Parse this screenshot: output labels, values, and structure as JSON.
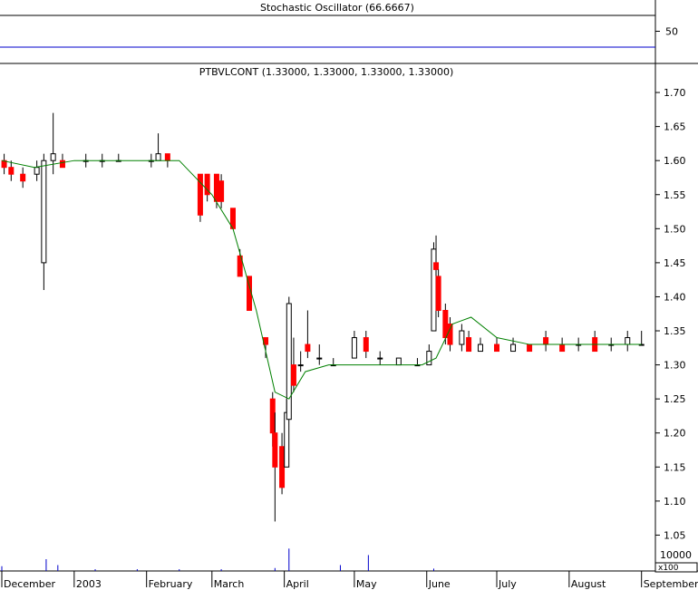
{
  "chart_data": [
    {
      "type": "line",
      "title": "Stochastic Oscillator (66.6667)",
      "ylim": [
        0,
        100
      ],
      "y_ticks": [
        50
      ],
      "ref_lines": [
        {
          "value": 80,
          "color": "#000000"
        },
        {
          "value": 20,
          "color": "#0000cc"
        }
      ],
      "series": [],
      "colors": {
        "line": "#cc0000"
      }
    },
    {
      "type": "candlestick",
      "title": "PTBVLCONT (1.33000, 1.33000, 1.33000, 1.33000)",
      "ylim": [
        1.0,
        1.74
      ],
      "y_ticks": [
        "1.05",
        "1.10",
        "1.15",
        "1.20",
        "1.25",
        "1.30",
        "1.35",
        "1.40",
        "1.45",
        "1.50",
        "1.55",
        "1.60",
        "1.65",
        "1.70"
      ],
      "moving_average": {
        "color": "#008000",
        "points": [
          [
            "2002-12-01",
            1.6
          ],
          [
            "2002-12-15",
            1.59
          ],
          [
            "2003-01-01",
            1.6
          ],
          [
            "2003-01-15",
            1.6
          ],
          [
            "2003-02-01",
            1.6
          ],
          [
            "2003-02-15",
            1.6
          ],
          [
            "2003-03-01",
            1.55
          ],
          [
            "2003-03-10",
            1.5
          ],
          [
            "2003-03-20",
            1.38
          ],
          [
            "2003-03-28",
            1.26
          ],
          [
            "2003-04-03",
            1.25
          ],
          [
            "2003-04-10",
            1.29
          ],
          [
            "2003-04-20",
            1.3
          ],
          [
            "2003-05-01",
            1.3
          ],
          [
            "2003-05-15",
            1.3
          ],
          [
            "2003-05-30",
            1.3
          ],
          [
            "2003-06-05",
            1.31
          ],
          [
            "2003-06-12",
            1.36
          ],
          [
            "2003-06-20",
            1.37
          ],
          [
            "2003-07-01",
            1.34
          ],
          [
            "2003-07-15",
            1.33
          ],
          [
            "2003-08-01",
            1.33
          ],
          [
            "2003-08-15",
            1.33
          ],
          [
            "2003-09-01",
            1.33
          ]
        ]
      },
      "candles": [
        [
          "2002-12-02",
          1.6,
          1.61,
          1.58,
          1.59
        ],
        [
          "2002-12-05",
          1.59,
          1.6,
          1.57,
          1.58
        ],
        [
          "2002-12-10",
          1.58,
          1.59,
          1.56,
          1.57
        ],
        [
          "2002-12-16",
          1.58,
          1.6,
          1.57,
          1.59
        ],
        [
          "2002-12-19",
          1.45,
          1.61,
          1.41,
          1.6
        ],
        [
          "2002-12-23",
          1.6,
          1.67,
          1.58,
          1.61
        ],
        [
          "2002-12-27",
          1.6,
          1.61,
          1.59,
          1.59
        ],
        [
          "2003-01-06",
          1.6,
          1.61,
          1.59,
          1.6
        ],
        [
          "2003-01-13",
          1.6,
          1.61,
          1.59,
          1.6
        ],
        [
          "2003-01-20",
          1.6,
          1.61,
          1.6,
          1.6
        ],
        [
          "2003-02-03",
          1.6,
          1.61,
          1.59,
          1.6
        ],
        [
          "2003-02-06",
          1.6,
          1.64,
          1.6,
          1.61
        ],
        [
          "2003-02-10",
          1.61,
          1.61,
          1.59,
          1.6
        ],
        [
          "2003-02-24",
          1.58,
          1.58,
          1.51,
          1.52
        ],
        [
          "2003-02-27",
          1.58,
          1.58,
          1.54,
          1.55
        ],
        [
          "2003-03-03",
          1.58,
          1.58,
          1.53,
          1.54
        ],
        [
          "2003-03-05",
          1.57,
          1.58,
          1.53,
          1.54
        ],
        [
          "2003-03-10",
          1.53,
          1.53,
          1.5,
          1.5
        ],
        [
          "2003-03-13",
          1.46,
          1.47,
          1.43,
          1.43
        ],
        [
          "2003-03-17",
          1.43,
          1.43,
          1.38,
          1.38
        ],
        [
          "2003-03-24",
          1.34,
          1.34,
          1.31,
          1.33
        ],
        [
          "2003-03-27",
          1.25,
          1.26,
          1.18,
          1.2
        ],
        [
          "2003-03-28",
          1.2,
          1.23,
          1.07,
          1.15
        ],
        [
          "2003-03-31",
          1.18,
          1.2,
          1.11,
          1.12
        ],
        [
          "2003-04-02",
          1.15,
          1.25,
          1.15,
          1.23
        ],
        [
          "2003-04-03",
          1.22,
          1.4,
          1.22,
          1.39
        ],
        [
          "2003-04-05",
          1.3,
          1.34,
          1.26,
          1.27
        ],
        [
          "2003-04-08",
          1.3,
          1.32,
          1.29,
          1.3
        ],
        [
          "2003-04-11",
          1.33,
          1.38,
          1.31,
          1.32
        ],
        [
          "2003-04-16",
          1.31,
          1.33,
          1.3,
          1.31
        ],
        [
          "2003-04-22",
          1.3,
          1.31,
          1.3,
          1.3
        ],
        [
          "2003-05-01",
          1.31,
          1.35,
          1.31,
          1.34
        ],
        [
          "2003-05-06",
          1.34,
          1.35,
          1.31,
          1.32
        ],
        [
          "2003-05-12",
          1.31,
          1.32,
          1.3,
          1.31
        ],
        [
          "2003-05-20",
          1.3,
          1.31,
          1.3,
          1.31
        ],
        [
          "2003-05-28",
          1.3,
          1.31,
          1.3,
          1.3
        ],
        [
          "2003-06-02",
          1.3,
          1.33,
          1.3,
          1.32
        ],
        [
          "2003-06-04",
          1.35,
          1.48,
          1.35,
          1.47
        ],
        [
          "2003-06-05",
          1.45,
          1.49,
          1.43,
          1.44
        ],
        [
          "2003-06-06",
          1.43,
          1.44,
          1.37,
          1.38
        ],
        [
          "2003-06-09",
          1.38,
          1.39,
          1.33,
          1.34
        ],
        [
          "2003-06-11",
          1.36,
          1.37,
          1.32,
          1.33
        ],
        [
          "2003-06-16",
          1.33,
          1.36,
          1.32,
          1.35
        ],
        [
          "2003-06-19",
          1.34,
          1.35,
          1.32,
          1.32
        ],
        [
          "2003-06-24",
          1.32,
          1.34,
          1.32,
          1.33
        ],
        [
          "2003-07-01",
          1.33,
          1.34,
          1.32,
          1.32
        ],
        [
          "2003-07-08",
          1.32,
          1.34,
          1.32,
          1.33
        ],
        [
          "2003-07-15",
          1.33,
          1.33,
          1.32,
          1.32
        ],
        [
          "2003-07-22",
          1.34,
          1.35,
          1.32,
          1.33
        ],
        [
          "2003-07-29",
          1.33,
          1.34,
          1.32,
          1.32
        ],
        [
          "2003-08-05",
          1.33,
          1.34,
          1.32,
          1.33
        ],
        [
          "2003-08-12",
          1.34,
          1.35,
          1.32,
          1.32
        ],
        [
          "2003-08-19",
          1.33,
          1.34,
          1.32,
          1.33
        ],
        [
          "2003-08-26",
          1.33,
          1.35,
          1.32,
          1.34
        ],
        [
          "2003-09-01",
          1.33,
          1.35,
          1.33,
          1.33
        ]
      ],
      "colors": {
        "up": "#ffffff",
        "down": "#ff0000",
        "border": "#000000"
      }
    },
    {
      "type": "bar",
      "title": "",
      "ylabel": "x100",
      "y_ticks": [
        "10000"
      ],
      "values": [
        [
          "2002-12-01",
          800
        ],
        [
          "2002-12-20",
          2000
        ],
        [
          "2002-12-25",
          1000
        ],
        [
          "2003-01-10",
          300
        ],
        [
          "2003-01-28",
          300
        ],
        [
          "2003-02-15",
          300
        ],
        [
          "2003-03-05",
          300
        ],
        [
          "2003-03-28",
          500
        ],
        [
          "2003-04-03",
          3800
        ],
        [
          "2003-04-25",
          1000
        ],
        [
          "2003-05-07",
          2700
        ],
        [
          "2003-06-04",
          400
        ]
      ],
      "x_ticks": [
        "December",
        "2003",
        "February",
        "March",
        "April",
        "May",
        "June",
        "July",
        "August",
        "September"
      ],
      "colors": {
        "bar": "#0000cc"
      }
    }
  ]
}
